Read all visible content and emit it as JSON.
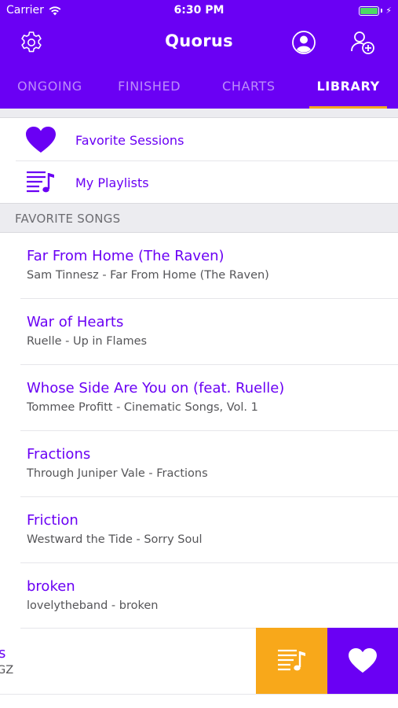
{
  "status_bar": {
    "carrier": "Carrier",
    "time": "6:30 PM"
  },
  "header": {
    "title": "Quorus",
    "icons": {
      "left": "settings-gear-icon",
      "profile": "user-profile-icon",
      "add_user": "add-user-icon"
    }
  },
  "tabs": [
    {
      "label": "ONGOING",
      "active": false
    },
    {
      "label": "FINISHED",
      "active": false
    },
    {
      "label": "CHARTS",
      "active": false
    },
    {
      "label": "LIBRARY",
      "active": true
    }
  ],
  "shortcuts": [
    {
      "label": "Favorite Sessions",
      "icon": "heart-icon"
    },
    {
      "label": "My Playlists",
      "icon": "playlist-icon"
    }
  ],
  "section": {
    "title": "FAVORITE SONGS"
  },
  "songs": [
    {
      "title": "Far From Home (The Raven)",
      "subtitle": "Sam Tinnesz - Far From Home (The Raven)"
    },
    {
      "title": "War of Hearts",
      "subtitle": "Ruelle - Up in Flames"
    },
    {
      "title": "Whose Side Are You on (feat. Ruelle)",
      "subtitle": "Tommee Profitt - Cinematic Songs, Vol. 1"
    },
    {
      "title": "Fractions",
      "subtitle": "Through Juniper Vale - Fractions"
    },
    {
      "title": "Friction",
      "subtitle": "Westward the Tide - Sorry Soul"
    },
    {
      "title": "broken",
      "subtitle": "lovelytheband - broken"
    }
  ],
  "swiped_row": {
    "title_fragment": "s",
    "subtitle_fragment": "GZ",
    "actions": [
      {
        "name": "add-to-playlist",
        "icon": "playlist-icon",
        "color": "#f8a81a"
      },
      {
        "name": "favorite",
        "icon": "heart-icon",
        "color": "#6a00f4"
      }
    ]
  },
  "colors": {
    "accent": "#6a00f4",
    "tab_indicator": "#f5a623",
    "battery": "#4cd964"
  }
}
